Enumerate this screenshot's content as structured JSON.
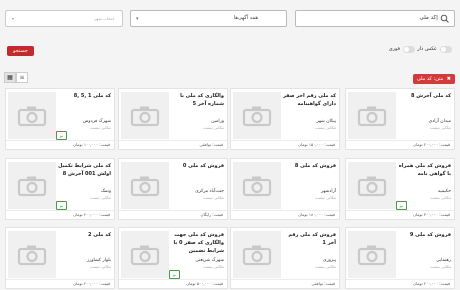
{
  "search": {
    "value": "کد ملی|"
  },
  "ads_select": {
    "value": "همه آگهی‌ها"
  },
  "city_select": {
    "placeholder": "انتخاب شهر"
  },
  "filters": {
    "with_photo_label": "عکس دار",
    "urgent_label": "فوری",
    "search_button": "جستجو",
    "chip_label": "متن: کد ملی"
  },
  "view": {
    "grid_icon": "grid-icon",
    "list_icon": "list-icon"
  },
  "cards": [
    {
      "title": "کد ملی آخرش 8",
      "store": "میدان آزادی",
      "city": "مکانی نیست",
      "price": "قیمت: ۲۰۰,۰۰۰ تومان",
      "badge": ""
    },
    {
      "title": "کد ملی رقم اخر صفر دارای گواهینامه",
      "store": "پیکان شهر",
      "city": "مکانی نیست",
      "price": "قیمت: ۱۵۰,۰۰۰ تومان",
      "badge": ""
    },
    {
      "title": "والگاری کد ملی با شماره آخر 5",
      "store": "ورامین",
      "city": "مکانی نیست",
      "price": "قیمت: توافقی",
      "badge": ""
    },
    {
      "title": "کد ملی 1 ,5 ,8",
      "store": "شهرک فردوس",
      "city": "مکانی نیست",
      "price": "قیمت: ۱۰۰,۰۰۰ تومان",
      "badge": "نو"
    },
    {
      "title": "فروش کد ملی همراه با گواهی نامه",
      "store": "حکیمیه",
      "city": "مکانی نیست",
      "price": "قیمت: ۳۰۰,۰۰۰ تومان",
      "badge": "نو"
    },
    {
      "title": "فروش کد ملی 8",
      "store": "آزادشهر",
      "city": "مکانی نیست",
      "price": "قیمت: ۱۸۰,۰۰۰ تومان",
      "badge": ""
    },
    {
      "title": "فروش کد ملی 0",
      "store": "جنت‌آباد مرکزی",
      "city": "مکانی نیست",
      "price": "قیمت: رایگان",
      "badge": ""
    },
    {
      "title": "کد ملی شرایط تکمیل اولش 001 آخرش 8",
      "store": "ونمک",
      "city": "مکانی نیست",
      "price": "قیمت: ۲۰۰,۰۰۰ تومان",
      "badge": "نو"
    },
    {
      "title": "فروش کد ملی 9",
      "store": "رهنمایی",
      "city": "مکانی نیست",
      "price": "قیمت: ۲۰۰,۰۰۰ تومان",
      "badge": ""
    },
    {
      "title": "فروش کد ملی رقم آخر 1",
      "store": "پیروزی",
      "city": "مکانی نیست",
      "price": "قیمت: توافقی",
      "badge": ""
    },
    {
      "title": "فروش کد ملی جهت والگاری کد صفر 0 با شرایط تضمین",
      "store": "شهرک شریعتی",
      "city": "مکانی نیست",
      "price": "قیمت: ۵۰۰,۰۰۰ تومان",
      "badge": "نو"
    },
    {
      "title": "کد ملی 2",
      "store": "بلوار کشاورز",
      "city": "مکانی نیست",
      "price": "قیمت: ۲۰۰,۰۰۰ تومان",
      "badge": ""
    }
  ]
}
